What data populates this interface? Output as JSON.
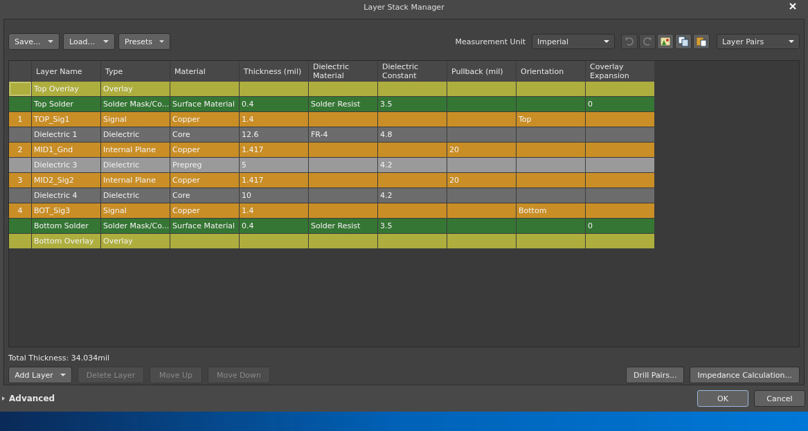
{
  "window": {
    "title": "Layer Stack Manager"
  },
  "toolbar": {
    "menus": [
      {
        "label": "Save..."
      },
      {
        "label": "Load..."
      },
      {
        "label": "Presets"
      }
    ],
    "unit_label": "Measurement Unit",
    "unit_value": "Imperial",
    "icon_buttons": [
      {
        "kind": "undo",
        "disabled": true
      },
      {
        "kind": "redo",
        "disabled": true
      },
      {
        "kind": "picture",
        "disabled": false
      },
      {
        "kind": "copy",
        "disabled": false
      },
      {
        "kind": "paste",
        "disabled": false
      }
    ],
    "view_value": "Layer Pairs"
  },
  "table": {
    "columns": [
      "",
      "Layer Name",
      "Type",
      "Material",
      "Thickness (mil)",
      "Dielectric Material",
      "Dielectric Constant",
      "Pullback (mil)",
      "Orientation",
      "Coverlay Expansion"
    ],
    "rows": [
      {
        "kind": "overlay",
        "selected": true,
        "cells": [
          "",
          "Top Overlay",
          "Overlay",
          "",
          "",
          "",
          "",
          "",
          "",
          ""
        ]
      },
      {
        "kind": "solder",
        "selected": false,
        "cells": [
          "",
          "Top Solder",
          "Solder Mask/Co...",
          "Surface Material",
          "0.4",
          "Solder Resist",
          "3.5",
          "",
          "",
          "0"
        ]
      },
      {
        "kind": "signal",
        "selected": false,
        "cells": [
          "1",
          "TOP_Sig1",
          "Signal",
          "Copper",
          "1.4",
          "",
          "",
          "",
          "Top",
          ""
        ]
      },
      {
        "kind": "core",
        "selected": false,
        "cells": [
          "",
          "Dielectric 1",
          "Dielectric",
          "Core",
          "12.6",
          "FR-4",
          "4.8",
          "",
          "",
          ""
        ]
      },
      {
        "kind": "signal",
        "selected": false,
        "cells": [
          "2",
          "MID1_Gnd",
          "Internal Plane",
          "Copper",
          "1.417",
          "",
          "",
          "20",
          "",
          ""
        ]
      },
      {
        "kind": "prepreg",
        "selected": false,
        "cells": [
          "",
          "Dielectric 3",
          "Dielectric",
          "Prepreg",
          "5",
          "",
          "4.2",
          "",
          "",
          ""
        ]
      },
      {
        "kind": "signal",
        "selected": false,
        "cells": [
          "3",
          "MID2_Sig2",
          "Internal Plane",
          "Copper",
          "1.417",
          "",
          "",
          "20",
          "",
          ""
        ]
      },
      {
        "kind": "core",
        "selected": false,
        "cells": [
          "",
          "Dielectric 4",
          "Dielectric",
          "Core",
          "10",
          "",
          "4.2",
          "",
          "",
          ""
        ]
      },
      {
        "kind": "signal",
        "selected": false,
        "cells": [
          "4",
          "BOT_Sig3",
          "Signal",
          "Copper",
          "1.4",
          "",
          "",
          "",
          "Bottom",
          ""
        ]
      },
      {
        "kind": "solder",
        "selected": false,
        "cells": [
          "",
          "Bottom Solder",
          "Solder Mask/Co...",
          "Surface Material",
          "0.4",
          "Solder Resist",
          "3.5",
          "",
          "",
          "0"
        ]
      },
      {
        "kind": "overlay",
        "selected": false,
        "cells": [
          "",
          "Bottom Overlay",
          "Overlay",
          "",
          "",
          "",
          "",
          "",
          "",
          ""
        ]
      }
    ]
  },
  "total_thickness": "Total Thickness: 34.034mil",
  "layer_buttons": [
    {
      "label": "Add Layer",
      "dropdown": true,
      "disabled": false
    },
    {
      "label": "Delete Layer",
      "dropdown": false,
      "disabled": true
    },
    {
      "label": "Move Up",
      "dropdown": false,
      "disabled": true
    },
    {
      "label": "Move Down",
      "dropdown": false,
      "disabled": true
    }
  ],
  "right_buttons": [
    "Drill Pairs...",
    "Impedance Calculation..."
  ],
  "advanced": {
    "label": "Advanced",
    "expanded": false
  },
  "dialog_buttons": [
    {
      "label": "OK",
      "default": true
    },
    {
      "label": "Cancel",
      "default": false
    }
  ]
}
